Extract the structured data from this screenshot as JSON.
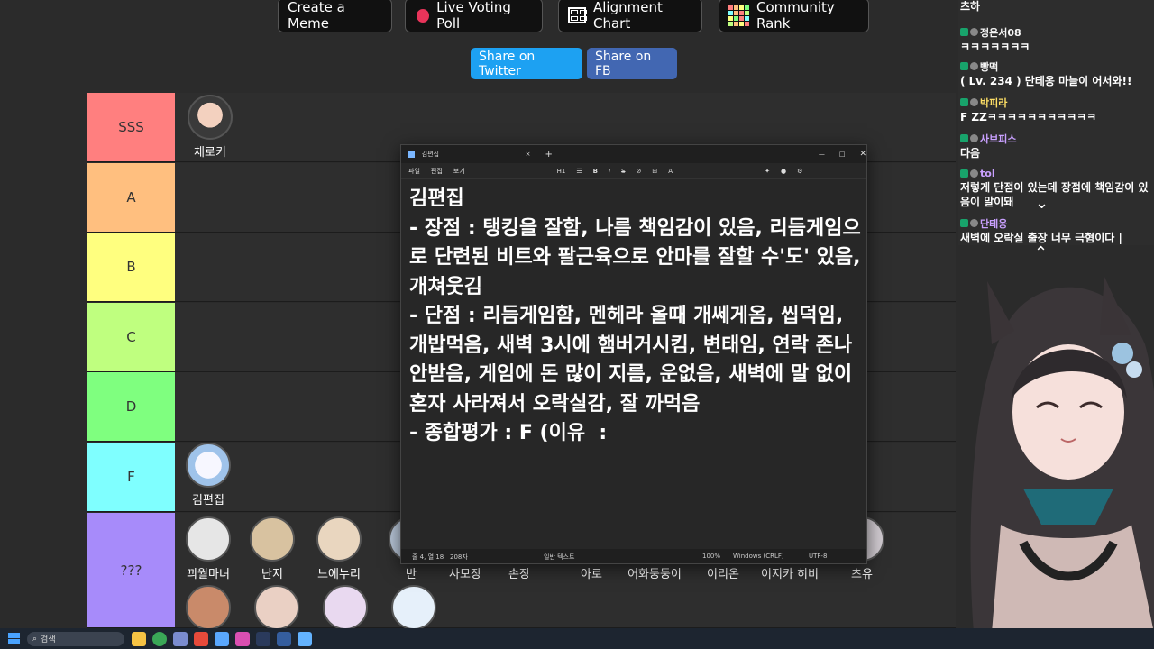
{
  "top_buttons": {
    "meme": "Create a Meme",
    "poll": "Live Voting Poll",
    "alignment": "Alignment Chart",
    "community": "Community Rank"
  },
  "share": {
    "twitter": "Share on Twitter",
    "fb": "Share on FB"
  },
  "tiers": [
    {
      "label": "SSS",
      "color": "#ff7f7f"
    },
    {
      "label": "A",
      "color": "#ffbf7f"
    },
    {
      "label": "B",
      "color": "#ffff7f"
    },
    {
      "label": "C",
      "color": "#bfff7f"
    },
    {
      "label": "D",
      "color": "#7fff7f"
    },
    {
      "label": "F",
      "color": "#7fffff"
    },
    {
      "label": "???",
      "color": "#a78bfa"
    }
  ],
  "tier_items": {
    "sss": "채로키",
    "f": "김편집",
    "unranked": [
      "끠월마녀",
      "난지",
      "느에누리",
      "반",
      "사모장",
      "손장",
      "아로",
      "어화둥둥이",
      "이리온",
      "이지카 히비",
      "츠유"
    ]
  },
  "notepad": {
    "tab_title": "김편집",
    "menu": [
      "파일",
      "편집",
      "보기"
    ],
    "heading": "H1",
    "body": "김편집\n- 장점 : 탱킹을 잘함, 나름 책임감이 있음, 리듬게임으로 단련된 비트와 팔근육으로 안마를 잘할 수'도' 있음, 개쳐웃김\n- 단점 : 리듬게임함, 멘헤라 올때 개쎄게옴, 씹덕임, 개밥먹음, 새벽 3시에 햄버거시킴, 변태임, 연락 존나 안받음, 게임에 돈 많이 지름, 운없음, 새벽에 말 없이 혼자 사라져서 오락실감, 잘 까먹음\n- 종합평가 : F (이유  :",
    "status": {
      "position": "줄 4, 열 18",
      "chars": "208자",
      "format": "일반 텍스트",
      "zoom": "100%",
      "eol": "Windows (CRLF)",
      "encoding": "UTF-8"
    }
  },
  "chat": [
    {
      "user": "",
      "text": "츠하",
      "color": "#f5f5f5"
    },
    {
      "user": "정은서08",
      "text": "ㅋㅋㅋㅋㅋㅋㅋ",
      "color": "#f5f5f5"
    },
    {
      "user": "빵떡",
      "text": "( Lv. 234 ) 단테옹 마늘이 어서와!!",
      "color": "#f5f5f5"
    },
    {
      "user": "박피라",
      "text": "F ZZㅋㅋㅋㅋㅋㅋㅋㅋㅋㅋㅋ",
      "color": "#ffe066"
    },
    {
      "user": "사브피스",
      "text": "다음",
      "color": "#c9a0ff"
    },
    {
      "user": "tol",
      "text": "저렇게 단점이 있는데 장점에 책임감이 있음이 말이돼",
      "color": "#c9a0ff"
    },
    {
      "user": "단테옹",
      "text": "새벽에 오락실 출장 너무 극혐이다 |",
      "color": "#c9a0ff"
    }
  ],
  "taskbar": {
    "search": "검색"
  }
}
